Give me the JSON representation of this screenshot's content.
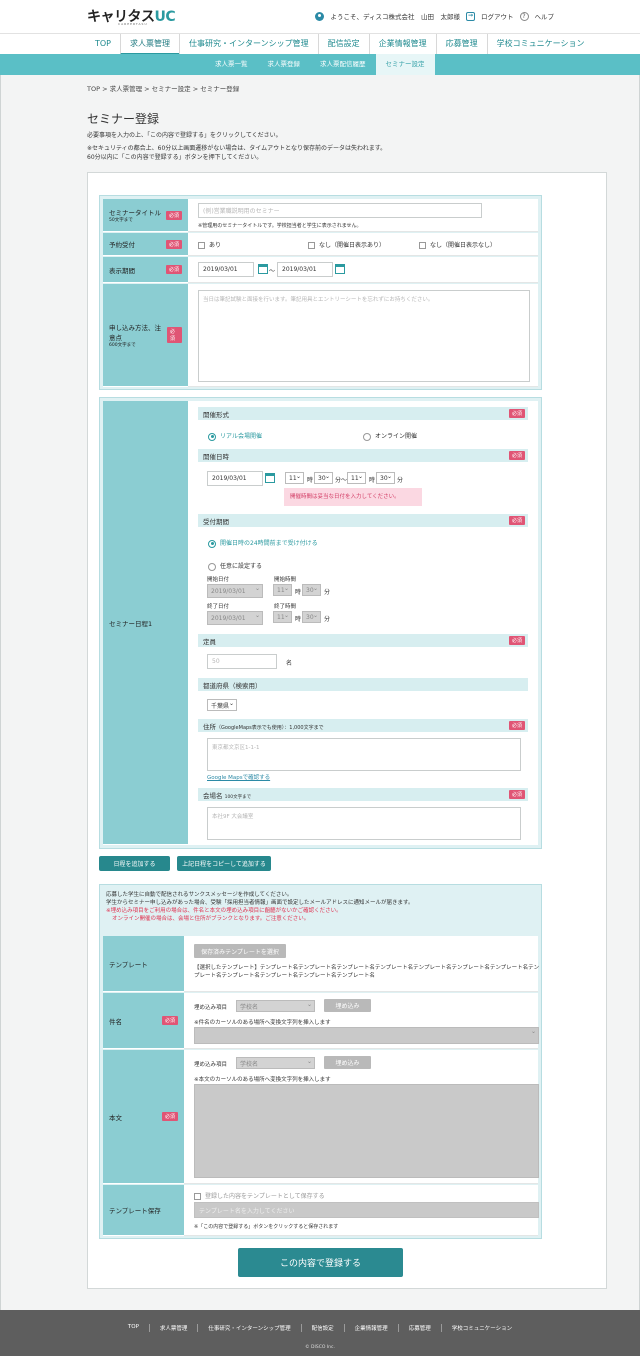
{
  "header": {
    "logo_main": "キャリタス",
    "logo_uc": "UC",
    "logo_sub": "CAREERTASU",
    "welcome": "ようこそ、ディスコ株式会社　山田　太郎様",
    "logout": "ログアウト",
    "help": "ヘルプ"
  },
  "gnav": [
    "TOP",
    "求人票管理",
    "仕事研究・インターンシップ管理",
    "配信設定",
    "企業情報管理",
    "応募管理",
    "学校コミュニケーション"
  ],
  "subnav": [
    "求人票一覧",
    "求人票登録",
    "求人票配信履歴",
    "セミナー設定"
  ],
  "breadcrumb": "TOP > 求人票管理 > セミナー設定 > セミナー登録",
  "page_title": "セミナー登録",
  "intro": {
    "line1": "必要事項を入力の上、「この内容で登録する」をクリックしてください。",
    "line2": "※セキュリティの都合上、60分以上画面遷移がない場合は、タイムアウトとなり保存前のデータは失われます。",
    "line3": "60分以内に「この内容で登録する」ボタンを押下してください。"
  },
  "form": {
    "req": "必須",
    "title_label": "セミナータイトル",
    "title_limit": "50文字まで",
    "title_placeholder": "(例)営業職説明用のセミナー",
    "title_note": "※管理用のセミナータイトルです。学校担当者と学生に表示されません。",
    "reserve_label": "予約受付",
    "reserve_opts": [
      "あり",
      "なし（開催日表示あり）",
      "なし（開催日表示なし）"
    ],
    "period_label": "表示期間",
    "period_from": "2019/03/01",
    "period_tilde": "～",
    "period_to": "2019/03/01",
    "method_label": "申し込み方法、注意点",
    "method_limit": "600文字まで",
    "method_placeholder": "当日は筆記試験と面接を行います。筆記用具とエントリーシートを忘れずにお持ちください。"
  },
  "schedule": {
    "side_label": "セミナー日程1",
    "format_head": "開催形式",
    "format_real": "リアル会場開催",
    "format_online": "オンライン開催",
    "date_head": "開催日時",
    "date_value": "2019/03/01",
    "h1": "11",
    "m1": "30",
    "h2": "11",
    "m2": "30",
    "ji": "時",
    "fun": "分",
    "fun_tilde": "分～",
    "error": "開催時間は妥当な日付を入力してください。",
    "accept_head": "受付期間",
    "accept_opt1": "開催日時の24時間前まで受け付ける",
    "accept_opt2": "任意に設定する",
    "start_date_label": "開始日付",
    "start_time_label": "開始時間",
    "end_date_label": "終了日付",
    "end_time_label": "終了時間",
    "dis_date": "2019/03/01",
    "dis_h": "11",
    "dis_m": "30",
    "capacity_head": "定員",
    "capacity_placeholder": "50",
    "capacity_unit": "名",
    "pref_head": "都道府県（検索用）",
    "pref_value": "千葉県",
    "address_head": "住所",
    "address_sub": "（GoogleMaps表示でも使用）：1,000文字まで",
    "address_placeholder": "東京都文京区1-1-1",
    "gmaps_link": "Google Mapsで確認する",
    "venue_head": "会場名",
    "venue_limit": "100文字まで",
    "venue_placeholder": "本社9F 大会議室"
  },
  "buttons": {
    "add_schedule": "日程を追加する",
    "copy_schedule": "上記日程をコピーして追加する",
    "submit": "この内容で登録する"
  },
  "message": {
    "info1": "応募した学生に自動で配信されるサンクスメッセージを作成してください。",
    "info2": "学生からセミナー申し込みがあった場合、受験「採用担当者情報」画面で設定したメールアドレスに通知メールが届きます。",
    "warn1": "※埋め込み項目をご利用の場合は、件名と本文の埋め込み項目に齟齬がないかご確認ください。",
    "warn2": "オンライン開催の場合は、会場と住所がブランクとなります。ご注意ください。",
    "template_label": "テンプレート",
    "template_btn": "保存済みテンプレートを選択",
    "template_selected": "【選択したテンプレート】テンプレート名テンプレート名テンプレート名テンプレート名テンプレート名テンプレート名テンプレート名テンプレート名テンプレート名テンプレート名テンプレート名テンプレート名",
    "subject_label": "件名",
    "embed_label": "埋め込み項目",
    "embed_value": "学校名",
    "embed_btn": "埋め込み",
    "subject_note": "※件名のカーソルのある場所へ変換文字列を挿入します",
    "body_label": "本文",
    "body_note": "※本文のカーソルのある場所へ変換文字列を挿入します",
    "save_label": "テンプレート保存",
    "save_check": "登録した内容をテンプレートとして保存する",
    "save_placeholder": "テンプレート名を入力してください",
    "save_note": "※「この内容で登録する」ボタンをクリックすると保存されます"
  },
  "footer": {
    "links": [
      "TOP",
      "求人票管理",
      "仕事研究・インターンシップ管理",
      "配信設定",
      "企業情報管理",
      "応募管理",
      "学校コミュニケーション"
    ],
    "copyright": "© DISCO Inc."
  },
  "colors": {
    "accent": "#2b9aa0",
    "label_bg": "#8bcdd2",
    "required": "#e05575",
    "footer": "#5e5e5e"
  }
}
